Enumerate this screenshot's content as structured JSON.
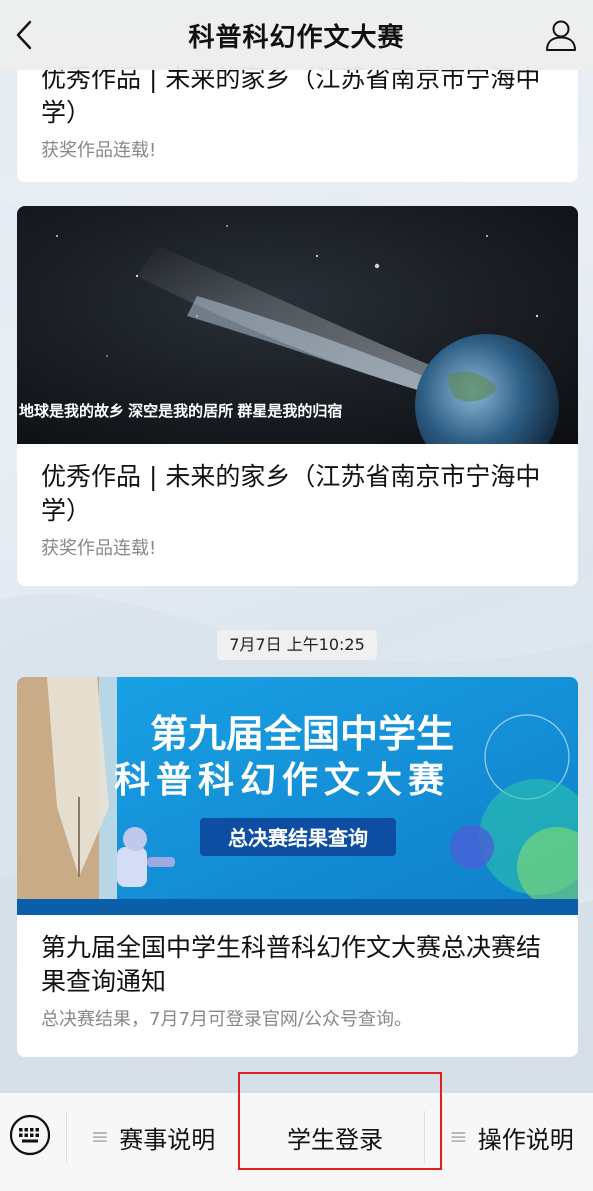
{
  "header": {
    "title": "科普科幻作文大赛"
  },
  "articles": [
    {
      "title": "优秀作品 | 未来的家乡（江苏省南京市宁海中学）",
      "desc": "获奖作品连载!"
    },
    {
      "title": "优秀作品 | 未来的家乡（江苏省南京市宁海中学）",
      "desc": "获奖作品连载!",
      "cover_text": "地球是我的故乡  深空是我的居所  群星是我的归宿"
    },
    {
      "title": "第九届全国中学生科普科幻作文大赛总决赛结果查询通知",
      "desc": "总决赛结果，7月7月可登录官网/公众号查询。",
      "cover_line1": "第九届全国中学生",
      "cover_line2": "科普科幻作文大赛",
      "cover_button": "总决赛结果查询"
    }
  ],
  "timestamp": "7月7日 上午10:25",
  "menu": [
    {
      "label": "赛事说明",
      "has_submenu": true
    },
    {
      "label": "学生登录",
      "has_submenu": false
    },
    {
      "label": "操作说明",
      "has_submenu": true
    }
  ],
  "icons": {
    "back": "chevron-left-icon",
    "profile": "person-icon",
    "keyboard": "keyboard-icon",
    "submenu": "hamburger-icon"
  },
  "colors": {
    "highlight": "#e02020",
    "banner_blue": "#1f9ee0"
  }
}
